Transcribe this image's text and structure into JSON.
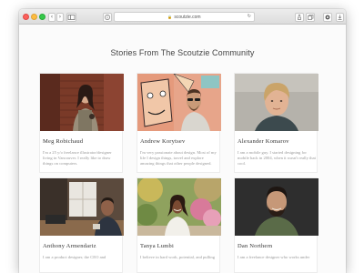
{
  "browser": {
    "url": "scoutzie.com",
    "nav_back": "‹",
    "nav_forward": "›"
  },
  "page": {
    "title": "Stories From The Scoutzie Community"
  },
  "profiles": [
    {
      "name": "Meg Robichaud",
      "bio": "I'm a 25 y/o freelance illustrator/designer living in Vancouver. I really like to draw things on computers.",
      "photo": "woman-brick-wall"
    },
    {
      "name": "Andrew Korytsev",
      "bio": "I'm very passionate about design. Most of my life I design things, travel and explore amazing things that other people designed.",
      "photo": "man-tribal-mural"
    },
    {
      "name": "Alexander Komarov",
      "bio": "I am a mobile guy. I started designing for mobile back in 2004, when it wasn't really that cool.",
      "photo": "blond-man-portrait"
    },
    {
      "name": "Anthony Armendariz",
      "bio": "I am a product designer, the CEO and",
      "photo": "man-desk-window"
    },
    {
      "name": "Tanya Lumbi",
      "bio": "I believe in hard work, potential, and pulling",
      "photo": "woman-garden"
    },
    {
      "name": "Dan Northern",
      "bio": "I am a freelance designer who works under",
      "photo": "bearded-man-dark"
    }
  ]
}
